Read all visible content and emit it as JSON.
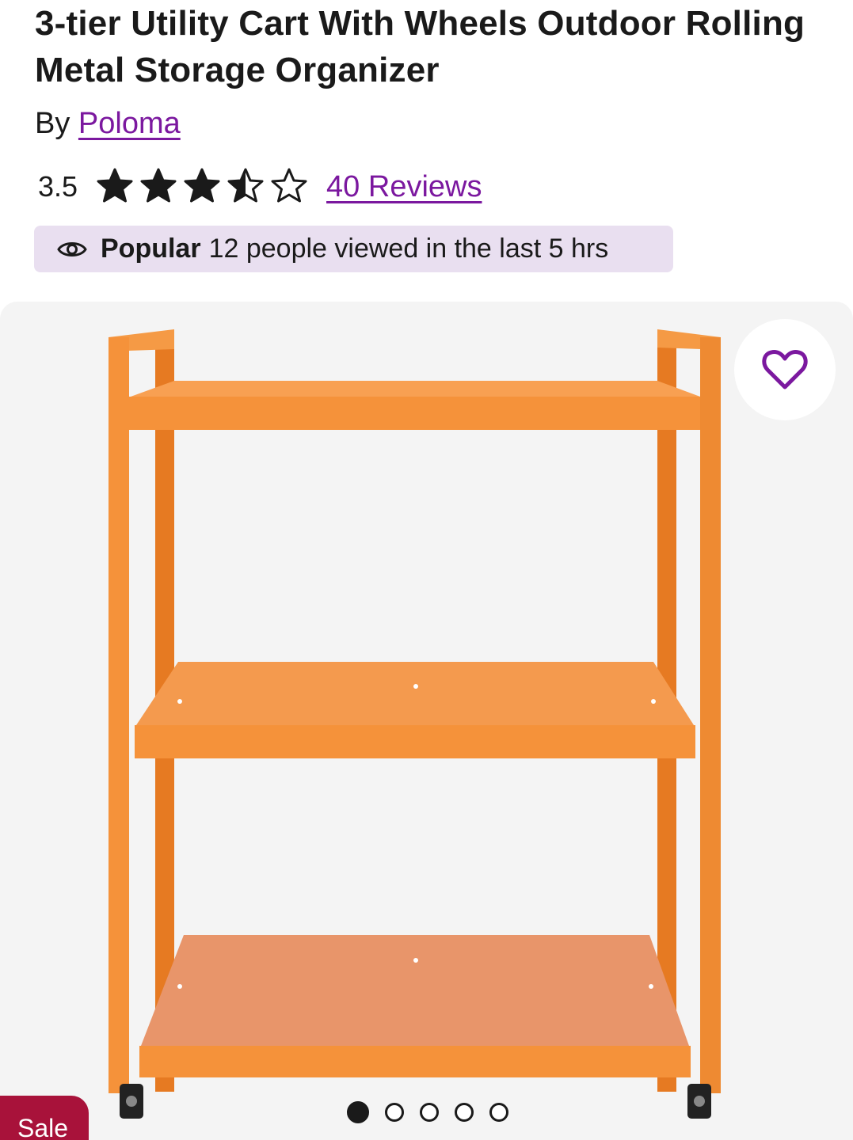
{
  "product": {
    "title": "3-tier Utility Cart With Wheels Outdoor Rolling Metal Storage Organizer",
    "by_prefix": "By",
    "brand": "Poloma"
  },
  "rating": {
    "value": "3.5",
    "stars_filled": 3.5,
    "stars_total": 5,
    "reviews_link": "40 Reviews"
  },
  "popular_badge": {
    "label": "Popular",
    "text": "12 people viewed in the last 5 hrs",
    "icon": "eye-icon"
  },
  "gallery": {
    "image_count": 5,
    "active_index": 0,
    "badge": "Sale",
    "favorite_icon": "heart-outline-icon"
  },
  "colors": {
    "link": "#7b189f",
    "badge_bg": "#e9dff0",
    "sale_bg": "#a8123a",
    "gallery_bg": "#f4f4f4",
    "product_orange": "#f28a2e"
  }
}
